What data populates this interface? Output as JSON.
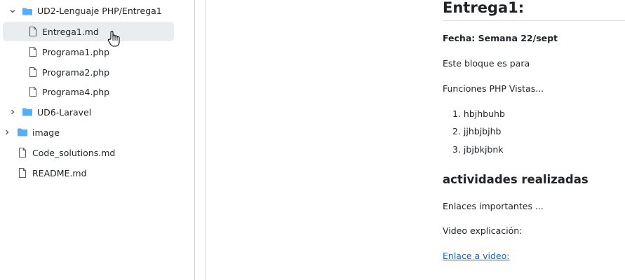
{
  "file_tree": {
    "items": [
      {
        "label": "UD2-Lenguaje PHP/Entrega1",
        "type": "folder",
        "expanded": true,
        "depth": 1,
        "icon": "folder-open-icon"
      },
      {
        "label": "Entrega1.md",
        "type": "file",
        "depth": 2,
        "selected": true,
        "icon": "file-icon"
      },
      {
        "label": "Programa1.php",
        "type": "file",
        "depth": 2,
        "icon": "file-icon"
      },
      {
        "label": "Programa2.php",
        "type": "file",
        "depth": 2,
        "icon": "file-icon"
      },
      {
        "label": "Programa4.php",
        "type": "file",
        "depth": 2,
        "icon": "file-icon"
      },
      {
        "label": "UD6-Laravel",
        "type": "folder",
        "expanded": false,
        "depth": 1,
        "icon": "folder-icon"
      },
      {
        "label": "image",
        "type": "folder",
        "expanded": false,
        "depth": 0,
        "icon": "folder-icon"
      },
      {
        "label": "Code_solutions.md",
        "type": "file",
        "depth": 0,
        "icon": "file-icon"
      },
      {
        "label": "README.md",
        "type": "file",
        "depth": 0,
        "icon": "file-icon"
      }
    ]
  },
  "markdown": {
    "title": "Entrega1:",
    "date_line": "Fecha: Semana 22/sept",
    "para1": "Este bloque es para",
    "para2": "Funciones PHP Vistas...",
    "list": [
      "hbjhbuhb",
      "jjhbjbjhb",
      "jbjbkjbnk"
    ],
    "section_heading": "actividades realizadas",
    "para3": "Enlaces importantes ...",
    "para4": "Video explicación:",
    "link_text": "Enlace a video:"
  },
  "colors": {
    "folder": "#54aeff",
    "link": "#0969da",
    "selected_bg": "#eaedf0",
    "border": "#d0d7de"
  }
}
